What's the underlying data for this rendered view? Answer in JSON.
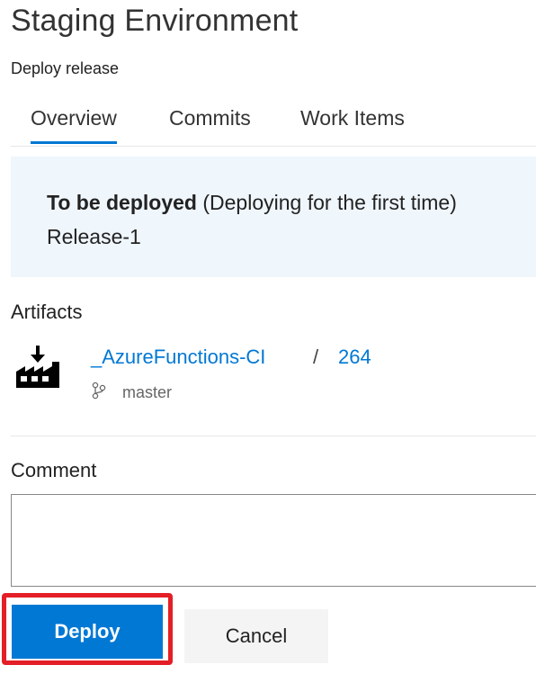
{
  "header": {
    "title": "Staging Environment",
    "subtitle": "Deploy release"
  },
  "tabs": [
    {
      "label": "Overview",
      "active": true
    },
    {
      "label": "Commits",
      "active": false
    },
    {
      "label": "Work Items",
      "active": false
    }
  ],
  "deployment_info": {
    "status_label": "To be deployed",
    "status_note": "(Deploying for the first time)",
    "release_name": "Release-1"
  },
  "artifacts": {
    "label": "Artifacts",
    "items": [
      {
        "icon": "build-pipeline-icon",
        "name": "_AzureFunctions-CI",
        "separator": "/",
        "build": "264",
        "branch_icon": "branch-icon",
        "branch": "master"
      }
    ]
  },
  "comment": {
    "label": "Comment",
    "value": "",
    "placeholder": ""
  },
  "actions": {
    "deploy_label": "Deploy",
    "cancel_label": "Cancel"
  },
  "colors": {
    "accent": "#0078d4",
    "info_background": "#eff6fc",
    "highlight": "#e41e26"
  }
}
